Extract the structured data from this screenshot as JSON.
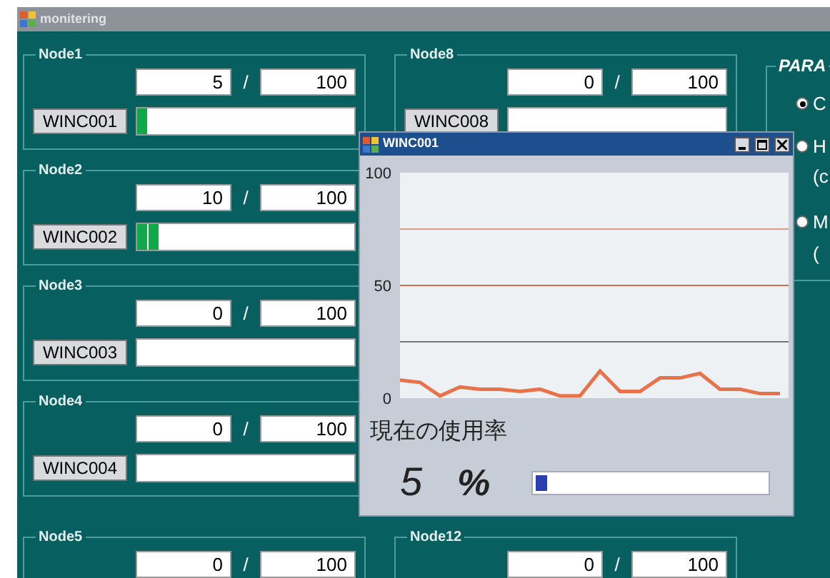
{
  "window": {
    "title": "monitering"
  },
  "columns": [
    {
      "nodes": [
        {
          "title": "Node1",
          "value": "5",
          "separator": "/",
          "max": "100",
          "button": "WINC001",
          "level": 0.05
        },
        {
          "title": "Node2",
          "value": "10",
          "separator": "/",
          "max": "100",
          "button": "WINC002",
          "level": 0.1
        },
        {
          "title": "Node3",
          "value": "0",
          "separator": "/",
          "max": "100",
          "button": "WINC003",
          "level": 0
        },
        {
          "title": "Node4",
          "value": "0",
          "separator": "/",
          "max": "100",
          "button": "WINC004",
          "level": 0
        },
        {
          "title": "Node5",
          "value": "0",
          "separator": "/",
          "max": "100"
        }
      ]
    },
    {
      "nodes": [
        {
          "title": "Node8",
          "value": "0",
          "separator": "/",
          "max": "100",
          "button": "WINC008",
          "level": 0
        },
        {
          "title": "Node12",
          "value": "0",
          "separator": "/",
          "max": "100"
        }
      ]
    }
  ],
  "parameters": {
    "title": "PARA",
    "options": [
      {
        "label": "C",
        "selected": true
      },
      {
        "label": "H",
        "note": "(c",
        "selected": false
      },
      {
        "label": "M",
        "note": "(",
        "selected": false
      }
    ]
  },
  "popup": {
    "title": "WINC001",
    "chart_data": {
      "type": "line",
      "ylim": [
        0,
        100
      ],
      "yticks": [
        0,
        50,
        100
      ],
      "ref_lines": [
        {
          "axis": "y",
          "value": 75,
          "color": "#d99a86"
        },
        {
          "axis": "y",
          "value": 50,
          "color": "#c9725a"
        },
        {
          "axis": "y",
          "value": 25,
          "color": "#777777"
        }
      ],
      "series": [
        {
          "color": "#e8734a",
          "values": [
            8,
            7,
            1,
            5,
            4,
            4,
            3,
            4,
            1,
            1,
            12,
            3,
            3,
            9,
            9,
            11,
            4,
            4,
            2,
            2
          ]
        }
      ]
    },
    "usage_label": "現在の使用率",
    "usage_value": "5",
    "usage_unit": "%",
    "level": 0.05
  }
}
